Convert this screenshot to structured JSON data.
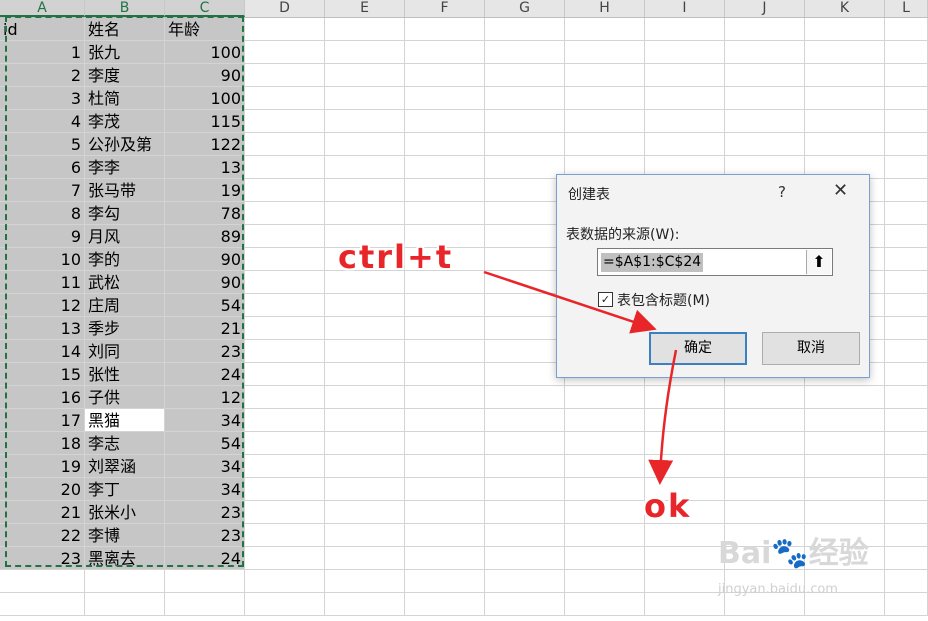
{
  "columns": [
    "A",
    "B",
    "C",
    "D",
    "E",
    "F",
    "G",
    "H",
    "I",
    "J",
    "K",
    "L"
  ],
  "header_row": {
    "id": "id",
    "name": "姓名",
    "age": "年龄"
  },
  "rows": [
    {
      "id": "1",
      "name": "张九",
      "age": "100"
    },
    {
      "id": "2",
      "name": "李度",
      "age": "90"
    },
    {
      "id": "3",
      "name": "杜简",
      "age": "100"
    },
    {
      "id": "4",
      "name": "李茂",
      "age": "115"
    },
    {
      "id": "5",
      "name": "公孙及第",
      "age": "122"
    },
    {
      "id": "6",
      "name": "李李",
      "age": "13"
    },
    {
      "id": "7",
      "name": "张马带",
      "age": "19"
    },
    {
      "id": "8",
      "name": "李勾",
      "age": "78"
    },
    {
      "id": "9",
      "name": "月风",
      "age": "89"
    },
    {
      "id": "10",
      "name": "李的",
      "age": "90"
    },
    {
      "id": "11",
      "name": "武松",
      "age": "90"
    },
    {
      "id": "12",
      "name": "庄周",
      "age": "54"
    },
    {
      "id": "13",
      "name": "季步",
      "age": "21"
    },
    {
      "id": "14",
      "name": "刘同",
      "age": "23"
    },
    {
      "id": "15",
      "name": "张性",
      "age": "24"
    },
    {
      "id": "16",
      "name": "子供",
      "age": "12"
    },
    {
      "id": "17",
      "name": "黑猫",
      "age": "34"
    },
    {
      "id": "18",
      "name": "李志",
      "age": "54"
    },
    {
      "id": "19",
      "name": "刘翠涵",
      "age": "34"
    },
    {
      "id": "20",
      "name": "李丁",
      "age": "34"
    },
    {
      "id": "21",
      "name": "张米小",
      "age": "23"
    },
    {
      "id": "22",
      "name": "李博",
      "age": "23"
    },
    {
      "id": "23",
      "name": "黑离去",
      "age": "24"
    }
  ],
  "dialog": {
    "title": "创建表",
    "help": "?",
    "close": "✕",
    "source_label": "表数据的来源(W):",
    "range_value": "=$A$1:$C$24",
    "picker_icon": "⬆",
    "has_headers_label": "表包含标题(M)",
    "has_headers_checked": "✓",
    "ok_label": "确定",
    "cancel_label": "取消"
  },
  "annotations": {
    "shortcut": "ctrl+t",
    "ok": "ok"
  },
  "watermark": {
    "text": "Bai🐾经验",
    "sub": "jingyan.baidu.com"
  },
  "colors": {
    "accent": "#217346",
    "annotation": "#e8262a",
    "selection_shade": "#c6c6c6"
  }
}
